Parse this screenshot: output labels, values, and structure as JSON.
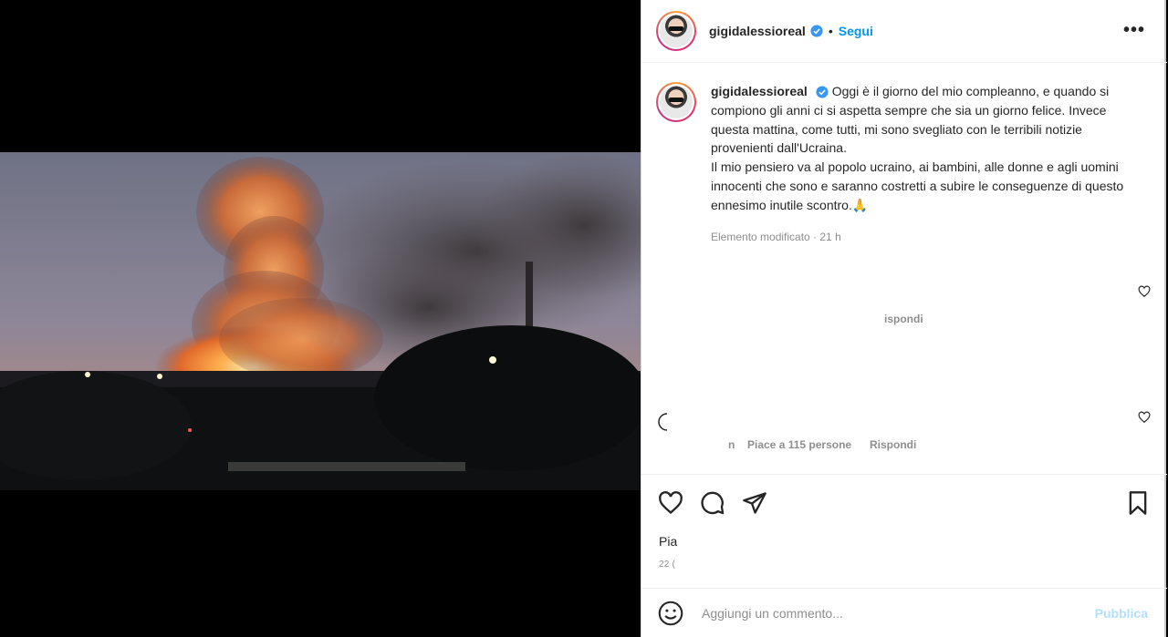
{
  "post": {
    "username": "gigidalessioreal",
    "follow_label": "Segui",
    "dot": "•",
    "more_label": "•••"
  },
  "caption": {
    "username": "gigidalessioreal",
    "text": "Oggi è il giorno del mio compleanno, e quando si compiono gli anni ci si aspetta sempre che sia un giorno felice. Invece questa mattina, come tutti, mi sono svegliato con le terribili notizie provenienti dall'Ucraina.\nIl mio pensiero va al popolo ucraino, ai bambini, alle donne e agli uomini innocenti che sono e saranno costretti a subire le conseguenze di questo ennesimo inutile scontro.🙏",
    "meta": "Elemento modificato · 21 h"
  },
  "comments": {
    "reply_1": "ispondi",
    "likes_2": "Piace a 115 persone",
    "reply_2": "Rispondi",
    "fragment_2": "n"
  },
  "footer": {
    "likes_partial": "Pia",
    "date_partial": "22 ("
  },
  "comment_box": {
    "placeholder": "Aggiungi un commento...",
    "publish_label": "Pubblica"
  },
  "icons": {
    "verified": "verified-badge-icon",
    "like": "heart-icon",
    "comment": "comment-bubble-icon",
    "share": "paper-plane-icon",
    "save": "bookmark-icon",
    "emoji": "smiley-icon"
  },
  "colors": {
    "accent": "#0095f6",
    "verified": "#3897f0",
    "publish_disabled": "#b2dffc"
  }
}
